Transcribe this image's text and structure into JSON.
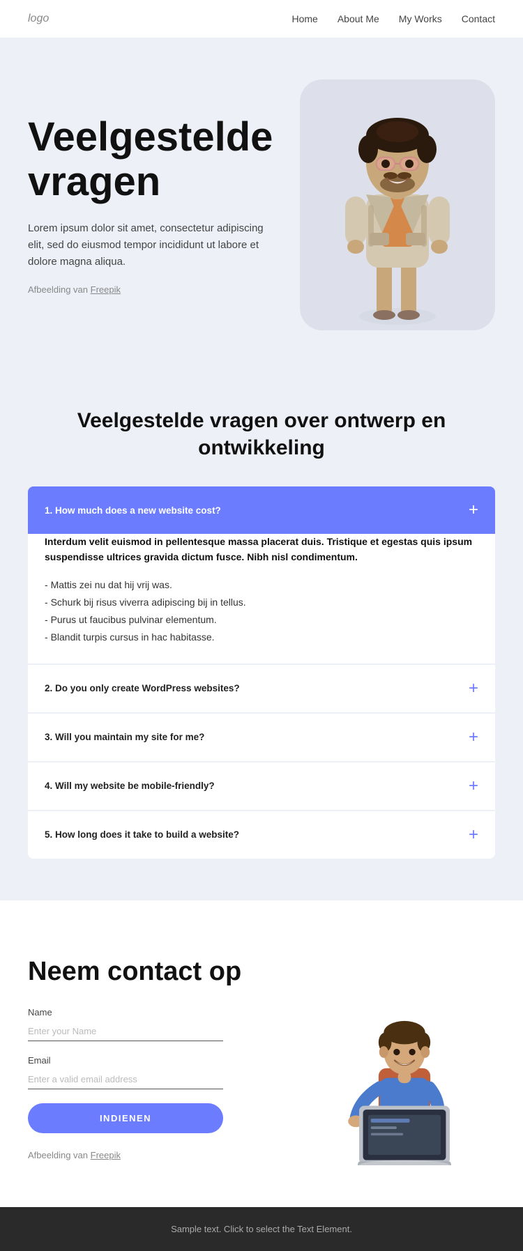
{
  "nav": {
    "logo": "logo",
    "links": [
      {
        "label": "Home",
        "id": "home"
      },
      {
        "label": "About Me",
        "id": "about"
      },
      {
        "label": "My Works",
        "id": "works"
      },
      {
        "label": "Contact",
        "id": "contact"
      }
    ]
  },
  "hero": {
    "title": "Veelgestelde vragen",
    "description": "Lorem ipsum dolor sit amet, consectetur adipiscing elit, sed do eiusmod tempor incididunt ut labore et dolore magna aliqua.",
    "credit_prefix": "Afbeelding van ",
    "credit_link": "Freepik",
    "credit_url": "#"
  },
  "faq": {
    "section_title": "Veelgestelde vragen over ontwerp en ontwikkeling",
    "items": [
      {
        "id": 1,
        "question": "1. How much does a new website cost?",
        "active": true,
        "answer_bold": "Interdum velit euismod in pellentesque massa placerat duis. Tristique et egestas quis ipsum suspendisse ultrices gravida dictum fusce. Nibh nisl condimentum.",
        "answer_list": [
          "Mattis zei nu dat hij vrij was.",
          "Schurk bij risus viverra adipiscing bij in tellus.",
          "Purus ut faucibus pulvinar elementum.",
          "Blandit turpis cursus in hac habitasse."
        ]
      },
      {
        "id": 2,
        "question": "2. Do you only create WordPress websites?",
        "active": false
      },
      {
        "id": 3,
        "question": "3. Will you maintain my site for me?",
        "active": false
      },
      {
        "id": 4,
        "question": "4. Will my website be mobile-friendly?",
        "active": false
      },
      {
        "id": 5,
        "question": "5. How long does it take to build a website?",
        "active": false
      }
    ]
  },
  "contact": {
    "title": "Neem contact op",
    "name_label": "Name",
    "name_placeholder": "Enter your Name",
    "email_label": "Email",
    "email_placeholder": "Enter a valid email address",
    "submit_label": "INDIENEN",
    "credit_prefix": "Afbeelding van ",
    "credit_link": "Freepik",
    "credit_url": "#"
  },
  "footer": {
    "text": "Sample text. Click to select the Text Element."
  }
}
